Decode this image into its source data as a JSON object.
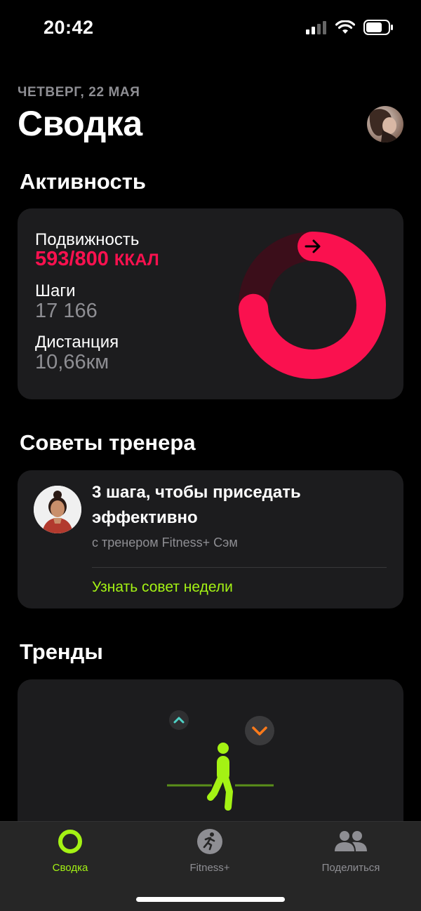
{
  "status_bar": {
    "time": "20:42"
  },
  "header": {
    "date": "ЧЕТВЕРГ, 22 МАЯ",
    "title": "Сводка"
  },
  "activity": {
    "section_title": "Активность",
    "move_label": "Подвижность",
    "move_value": "593/800",
    "move_unit": "ККАЛ",
    "move_progress": 0.741,
    "steps_label": "Шаги",
    "steps_value": "17 166",
    "distance_label": "Дистанция",
    "distance_value": "10,66км",
    "ring_color": "#fa114f"
  },
  "coach": {
    "section_title": "Советы тренера",
    "title": "3 шага, чтобы приседать эффективно",
    "subtitle": "с тренером Fitness+ Сэм",
    "link": "Узнать совет недели",
    "link_color": "#a4f214"
  },
  "trends": {
    "section_title": "Тренды"
  },
  "tab_bar": {
    "items": [
      {
        "label": "Сводка",
        "icon": "activity-ring-icon",
        "active": true
      },
      {
        "label": "Fitness+",
        "icon": "running-figure-icon",
        "active": false
      },
      {
        "label": "Поделиться",
        "icon": "people-icon",
        "active": false
      }
    ]
  }
}
